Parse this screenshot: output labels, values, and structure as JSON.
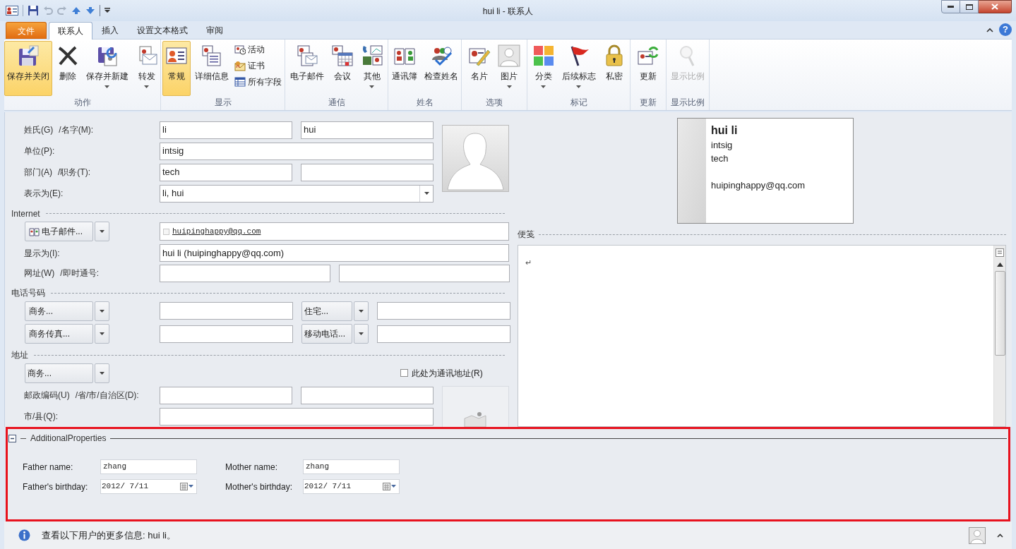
{
  "window": {
    "title": "hui li - 联系人"
  },
  "ribbon_tabs": [
    {
      "label": "文件",
      "kind": "file",
      "selected": false
    },
    {
      "label": "联系人",
      "kind": "tab",
      "selected": true
    },
    {
      "label": "插入",
      "kind": "tab",
      "selected": false
    },
    {
      "label": "设置文本格式",
      "kind": "tab",
      "selected": false
    },
    {
      "label": "审阅",
      "kind": "tab",
      "selected": false
    }
  ],
  "help_button": "?",
  "ribbon_groups": [
    {
      "label": "动作",
      "buttons": [
        {
          "label": "保存并关闭",
          "kind": "large",
          "selected": true,
          "dropdown": false,
          "disabled": false
        },
        {
          "label": "删除",
          "kind": "large",
          "selected": false,
          "dropdown": false,
          "disabled": false
        },
        {
          "label": "保存并新建",
          "kind": "large",
          "selected": false,
          "dropdown": true,
          "disabled": false
        },
        {
          "label": "转发",
          "kind": "large",
          "selected": false,
          "dropdown": true,
          "disabled": false
        }
      ]
    },
    {
      "label": "显示",
      "buttons": [
        {
          "label": "常规",
          "kind": "large",
          "selected": true,
          "dropdown": false,
          "disabled": false
        },
        {
          "label": "详细信息",
          "kind": "large",
          "selected": false,
          "dropdown": false,
          "disabled": false
        },
        {
          "label": "活动",
          "kind": "small"
        },
        {
          "label": "证书",
          "kind": "small"
        },
        {
          "label": "所有字段",
          "kind": "small"
        }
      ]
    },
    {
      "label": "通信",
      "buttons": [
        {
          "label": "电子邮件",
          "kind": "large",
          "selected": false,
          "dropdown": false,
          "disabled": false
        },
        {
          "label": "会议",
          "kind": "large",
          "selected": false,
          "dropdown": false,
          "disabled": false
        },
        {
          "label": "其他",
          "kind": "large",
          "selected": false,
          "dropdown": true,
          "disabled": false
        }
      ]
    },
    {
      "label": "姓名",
      "buttons": [
        {
          "label": "通讯簿",
          "kind": "large",
          "selected": false,
          "dropdown": false,
          "disabled": false
        },
        {
          "label": "检查姓名",
          "kind": "large",
          "selected": false,
          "dropdown": false,
          "disabled": false
        }
      ]
    },
    {
      "label": "选项",
      "buttons": [
        {
          "label": "名片",
          "kind": "large",
          "selected": false,
          "dropdown": false,
          "disabled": false
        },
        {
          "label": "图片",
          "kind": "large",
          "selected": false,
          "dropdown": true,
          "disabled": false
        }
      ]
    },
    {
      "label": "标记",
      "buttons": [
        {
          "label": "分类",
          "kind": "large",
          "selected": false,
          "dropdown": true,
          "disabled": false
        },
        {
          "label": "后续标志",
          "kind": "large",
          "selected": false,
          "dropdown": true,
          "disabled": false
        },
        {
          "label": "私密",
          "kind": "large",
          "selected": false,
          "dropdown": false,
          "disabled": false
        }
      ]
    },
    {
      "label": "更新",
      "buttons": [
        {
          "label": "更新",
          "kind": "large",
          "selected": false,
          "dropdown": false,
          "disabled": false
        }
      ]
    },
    {
      "label": "显示比例",
      "buttons": [
        {
          "label": "显示比例",
          "kind": "large",
          "selected": false,
          "dropdown": false,
          "disabled": true
        }
      ]
    }
  ],
  "name_rows": [
    {
      "kind": "pair",
      "label": "姓氏(G)",
      "label_2": "/名字(M):",
      "value": "li",
      "value_2": "hui"
    },
    {
      "kind": "single",
      "label": "单位(P):",
      "value": "intsig"
    },
    {
      "kind": "pair",
      "label": "部门(A)",
      "label_2": "/职务(T):",
      "value": "tech"
    },
    {
      "kind": "combo",
      "label": "表示为(E):",
      "value": "li, hui"
    }
  ],
  "sections": [
    {
      "heading": "Internet",
      "rows": [
        {
          "kind": "email",
          "button": "电子邮件...",
          "value": "huipinghappy@qq.com"
        },
        {
          "kind": "wide",
          "label": "显示为(I):",
          "value": "hui li (huipinghappy@qq.com)"
        },
        {
          "kind": "wide_pair",
          "label": "网址(W)",
          "label_2": "/即时通号:"
        }
      ]
    },
    {
      "heading": "电话号码",
      "rows": [
        {
          "kind": "phone",
          "button": "商务...",
          "button_2": "住宅..."
        },
        {
          "kind": "phone",
          "button": "商务传真...",
          "button_2": "移动电话..."
        }
      ]
    },
    {
      "heading": "地址",
      "rows": [
        {
          "kind": "address",
          "button": "商务...",
          "checkbox": "此处为通讯地址(R)",
          "checked": false
        },
        {
          "kind": "pair",
          "label": "邮政编码(U)",
          "label_2": "/省/市/自治区(D):"
        },
        {
          "kind": "single",
          "label": "市/县(Q):"
        }
      ]
    }
  ],
  "business_card": {
    "name": "hui li",
    "company": "intsig",
    "department": "tech",
    "email": "huipinghappy@qq.com"
  },
  "notes": {
    "heading": "便笺",
    "text": "↵"
  },
  "additional_properties": {
    "title": "AdditionalProperties",
    "expanded": true,
    "fields": [
      {
        "label": "Father name:",
        "kind": "text",
        "value": "zhang"
      },
      {
        "label": "Mother name:",
        "kind": "text",
        "value": "zhang"
      },
      {
        "label": "Father's birthday:",
        "kind": "date",
        "value": "2012/ 7/11"
      },
      {
        "label": "Mother's birthday:",
        "kind": "date",
        "value": "2012/ 7/11"
      }
    ]
  },
  "status_bar": {
    "text": "查看以下用户的更多信息: hui li。"
  }
}
